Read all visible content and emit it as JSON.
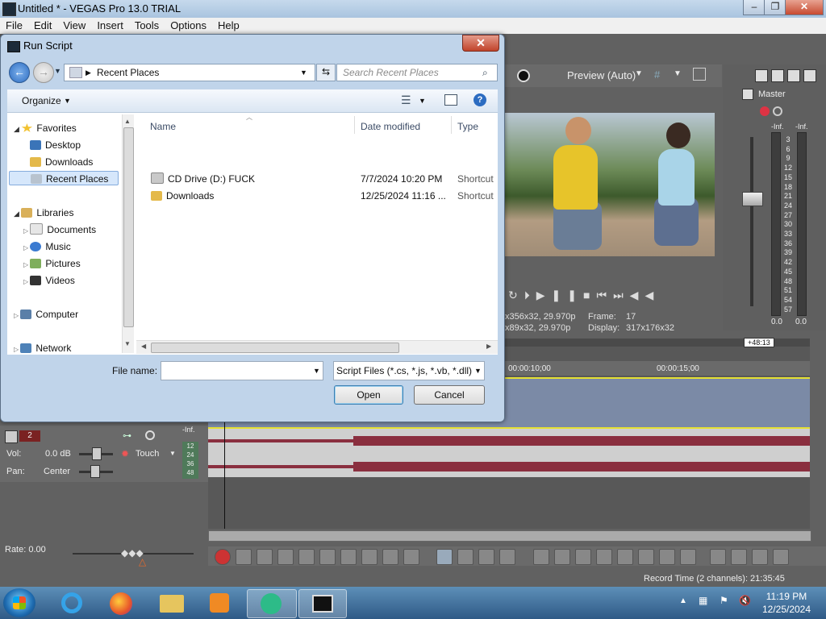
{
  "app": {
    "title": "Untitled * - VEGAS Pro 13.0 TRIAL",
    "menu": [
      "File",
      "Edit",
      "View",
      "Insert",
      "Tools",
      "Options",
      "Help"
    ]
  },
  "preview": {
    "mode": "Preview (Auto)",
    "project_info": "x356x32, 29.970p",
    "preview_info": "x89x32, 29.970p",
    "frame_label": "Frame:",
    "frame_value": "17",
    "display_label": "Display:",
    "display_value": "317x176x32"
  },
  "mixer": {
    "master_label": "Master",
    "inf_left": "-Inf.",
    "inf_right": "-Inf.",
    "scale": [
      "3",
      "6",
      "9",
      "12",
      "15",
      "18",
      "21",
      "24",
      "27",
      "30",
      "33",
      "36",
      "39",
      "42",
      "45",
      "48",
      "51",
      "54",
      "57"
    ],
    "bottom_left": "0.0",
    "bottom_right": "0.0"
  },
  "timeline": {
    "marker_10": "00:00:10;00",
    "marker_15": "00:00:15;00",
    "offset": "+48:13",
    "track_number": "2",
    "vol_label": "Vol:",
    "vol_value": "0.0 dB",
    "pan_label": "Pan:",
    "pan_value": "Center",
    "touch_label": "Touch",
    "inf": "-Inf.",
    "meter_ticks": [
      "12",
      "24",
      "36",
      "48"
    ],
    "rate_label": "Rate: 0.00",
    "record_time": "Record Time (2 channels): 21:35:45"
  },
  "dialog": {
    "title": "Run Script",
    "close_label": "✕",
    "address": "Recent Places",
    "search_placeholder": "Search Recent Places",
    "organize_label": "Organize",
    "nav": {
      "favorites": "Favorites",
      "desktop": "Desktop",
      "downloads": "Downloads",
      "recent_places": "Recent Places",
      "libraries": "Libraries",
      "documents": "Documents",
      "music": "Music",
      "pictures": "Pictures",
      "videos": "Videos",
      "computer": "Computer",
      "network": "Network"
    },
    "columns": {
      "name": "Name",
      "date": "Date modified",
      "type": "Type"
    },
    "files": [
      {
        "name": "CD Drive (D:) FUCK",
        "date": "7/7/2024 10:20 PM",
        "type": "Shortcut"
      },
      {
        "name": "Downloads",
        "date": "12/25/2024 11:16 ...",
        "type": "Shortcut"
      }
    ],
    "filename_label": "File name:",
    "filename_value": "",
    "filter": "Script Files (*.cs, *.js, *.vb, *.dll)",
    "open_label": "Open",
    "cancel_label": "Cancel"
  },
  "taskbar": {
    "time": "11:19 PM",
    "date": "12/25/2024"
  }
}
